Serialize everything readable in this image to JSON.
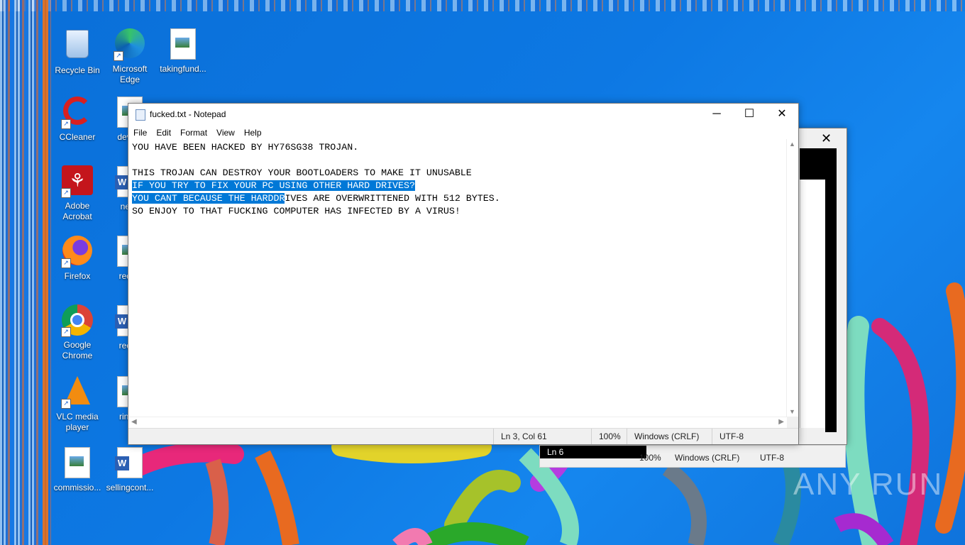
{
  "desktop": {
    "icons": [
      {
        "label": "Recycle Bin"
      },
      {
        "label": "Microsoft Edge"
      },
      {
        "label": "takingfund..."
      },
      {
        "label": "CCleaner"
      },
      {
        "label": "develo"
      },
      {
        "label": "Adobe Acrobat"
      },
      {
        "label": "need"
      },
      {
        "label": "Firefox"
      },
      {
        "label": "reque"
      },
      {
        "label": "Google Chrome"
      },
      {
        "label": "requir"
      },
      {
        "label": "VLC media player"
      },
      {
        "label": "ringto"
      },
      {
        "label": "commissio..."
      },
      {
        "label": "sellingcont..."
      }
    ],
    "watermark": "ANY RUN"
  },
  "notepad": {
    "title": "fucked.txt - Notepad",
    "controls": {
      "minimize": "─",
      "maximize": "☐",
      "close": "✕"
    },
    "menu": [
      "File",
      "Edit",
      "Format",
      "View",
      "Help"
    ],
    "lines": [
      "YOU HAVE BEEN HACKED BY HY76SG38 TROJAN.",
      "",
      "THIS TROJAN CAN DESTROY YOUR BOOTLOADERS TO MAKE IT UNUSABLE",
      "IF YOU TRY TO FIX YOUR PC USING OTHER HARD DRIVES?",
      "YOU CANT BECAUSE THE HARDDR",
      "IVES ARE OVERWRITTENED WITH 512 BYTES.",
      "SO ENJOY TO THAT FUCKING COMPUTER HAS INFECTED BY A VIRUS!"
    ],
    "status": {
      "position": "Ln 3, Col 61",
      "zoom": "100%",
      "line_ending": "Windows (CRLF)",
      "encoding": "UTF-8"
    }
  },
  "background_notepad": {
    "close": "✕",
    "status": {
      "position": "Ln 6",
      "zoom": "100%",
      "line_ending": "Windows (CRLF)",
      "encoding": "UTF-8"
    }
  }
}
